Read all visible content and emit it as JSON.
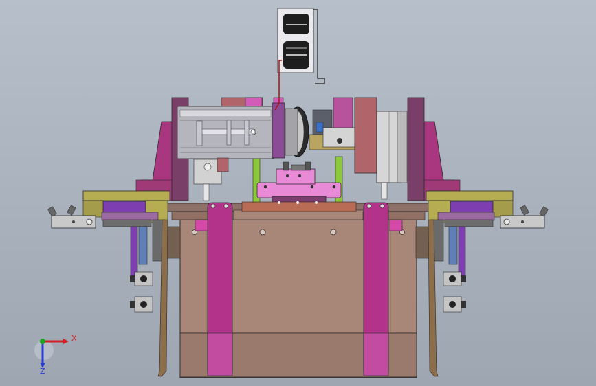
{
  "viewport": {
    "background": "#aab2be"
  },
  "colors": {
    "brown": "#a88678",
    "brown_dark": "#8c6e64",
    "magenta": "#b4338a",
    "magenta_light": "#e06cc4",
    "pink_block": "#e98ad6",
    "olive": "#b6ad53",
    "olive_dark": "#8f8a3e",
    "purple": "#7d3fb0",
    "green": "#8cc83a",
    "gray_part": "#c7c7c7",
    "dark_gray": "#5a5a5a",
    "rose": "#b0656b",
    "outline": "#2a2a2a"
  },
  "triad": {
    "x_label": "X",
    "z_label": "Z",
    "x_color": "#d42020",
    "z_color": "#2a3fcf",
    "y_color": "#1fa51f"
  }
}
